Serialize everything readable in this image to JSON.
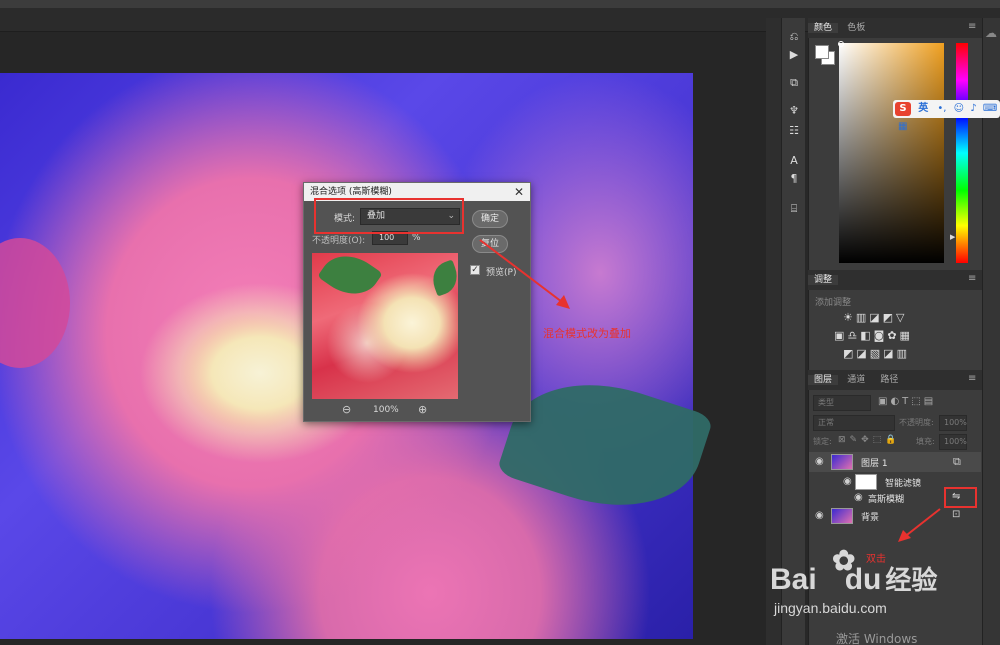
{
  "dialog": {
    "title": "混合选项 (高斯模糊)",
    "close": "✕",
    "mode_label": "模式:",
    "mode_value": "叠加",
    "opacity_label": "不透明度(O):",
    "opacity_value": "100",
    "opacity_unit": "%",
    "ok_button": "确定",
    "reset_button": "复位",
    "preview_label": "预览(P)",
    "preview_checked": true,
    "zoom_level": "100%"
  },
  "annotations": {
    "mode_note": "混合模式改为叠加",
    "click_note": "双击"
  },
  "panels": {
    "color_tabs": [
      "颜色",
      "色板"
    ],
    "adjust_tab": "调整",
    "adjust_hint": "添加调整",
    "layer_tabs": [
      "图层",
      "通道",
      "路径"
    ],
    "kind_filter": "类型",
    "blend_mode": "正常",
    "opacity_label": "不透明度:",
    "opacity_value": "100%",
    "lock_label": "锁定:",
    "fill_label": "填充:",
    "fill_value": "100%"
  },
  "layers": [
    {
      "name": "图层 1",
      "icon": "smart-object-icon"
    },
    {
      "name": "智能滤镜",
      "icon": "filter-mask-thumb"
    },
    {
      "name": "高斯模糊",
      "icon": "filter-options-icon"
    },
    {
      "name": "背景",
      "icon": "lock-icon"
    }
  ],
  "ime": {
    "logo": "S",
    "lang": "英"
  },
  "watermark": {
    "brand": "Bai",
    "brand2": "du",
    "brand_cn": "经验",
    "url": "jingyan.baidu.com",
    "windows": "激活 Windows"
  },
  "colors": {
    "annotation_red": "#e8322f",
    "panel_bg": "#3c3c3c"
  }
}
